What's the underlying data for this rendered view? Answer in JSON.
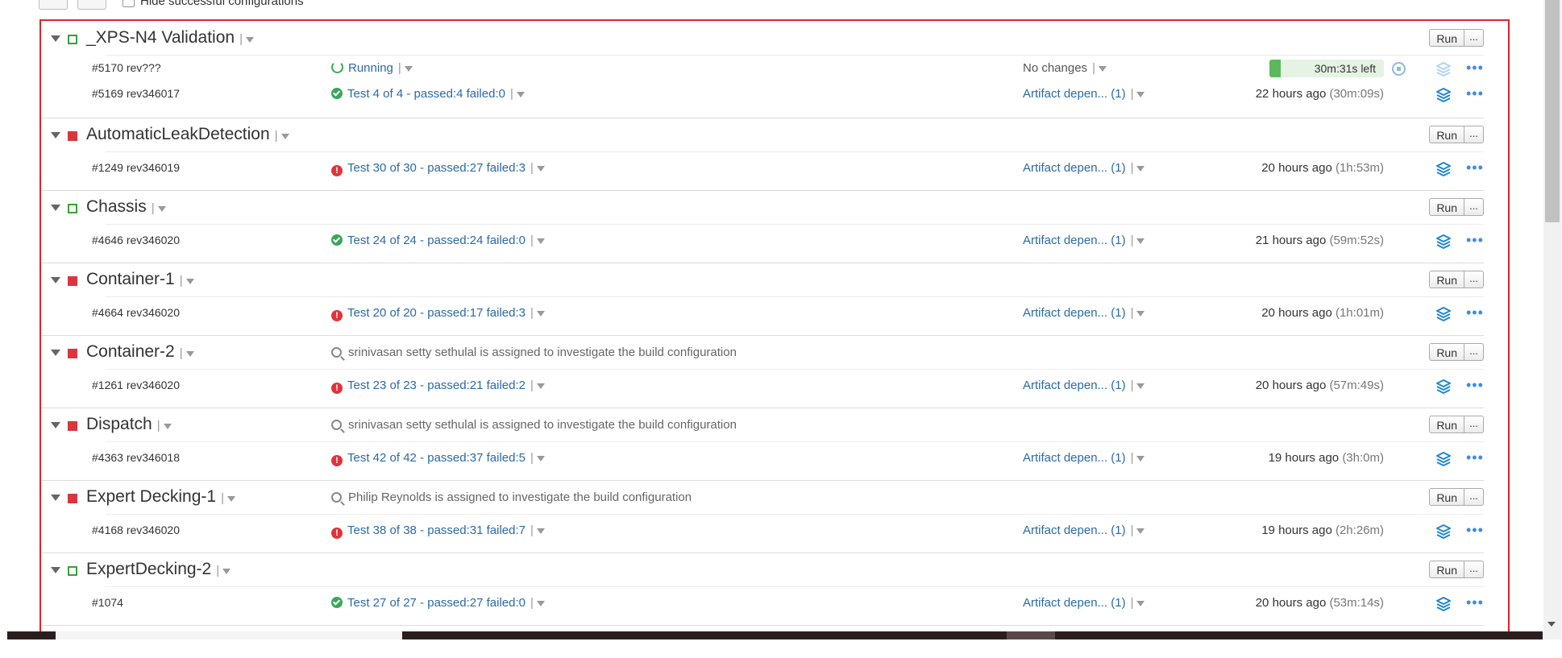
{
  "toolbar": {
    "hide_successful_label": "Hide successful configurations"
  },
  "run_label": "Run",
  "more_label": "...",
  "ellipsis_icon": "•••",
  "colors": {
    "success": "#3aa757",
    "failure": "#d9363e",
    "link": "#2a6aa8",
    "frame_highlight": "#e0242b"
  },
  "groups": [
    {
      "name": "_XPS-N4 Validation",
      "status": "success",
      "investigation": "",
      "builds": [
        {
          "number": "#5170 rev???",
          "status_icon": "running-icon",
          "status_text": "Running",
          "changes": "No changes",
          "time": "",
          "duration": "",
          "progress_text": "30m:31s left",
          "progress_fraction": 0.1
        },
        {
          "number": "#5169 rev346017",
          "status_icon": "success-icon",
          "status_text": "Test 4 of 4 - passed:4 failed:0",
          "changes": "Artifact depen... (1)",
          "time": "22 hours ago",
          "duration": "(30m:09s)"
        }
      ]
    },
    {
      "name": "AutomaticLeakDetection",
      "status": "failure",
      "investigation": "",
      "builds": [
        {
          "number": "#1249 rev346019",
          "status_icon": "error-icon",
          "status_text": "Test 30 of 30 - passed:27 failed:3",
          "changes": "Artifact depen... (1)",
          "time": "20 hours ago",
          "duration": "(1h:53m)"
        }
      ]
    },
    {
      "name": "Chassis",
      "status": "success",
      "investigation": "",
      "builds": [
        {
          "number": "#4646 rev346020",
          "status_icon": "success-icon",
          "status_text": "Test 24 of 24 - passed:24 failed:0",
          "changes": "Artifact depen... (1)",
          "time": "21 hours ago",
          "duration": "(59m:52s)"
        }
      ]
    },
    {
      "name": "Container-1",
      "status": "failure",
      "investigation": "",
      "builds": [
        {
          "number": "#4664 rev346020",
          "status_icon": "error-icon",
          "status_text": "Test 20 of 20 - passed:17 failed:3",
          "changes": "Artifact depen... (1)",
          "time": "20 hours ago",
          "duration": "(1h:01m)"
        }
      ]
    },
    {
      "name": "Container-2",
      "status": "failure",
      "investigation": "srinivasan setty sethulal is assigned to investigate the build configuration",
      "builds": [
        {
          "number": "#1261 rev346020",
          "status_icon": "error-icon",
          "status_text": "Test 23 of 23 - passed:21 failed:2",
          "changes": "Artifact depen... (1)",
          "time": "20 hours ago",
          "duration": "(57m:49s)"
        }
      ]
    },
    {
      "name": "Dispatch",
      "status": "failure",
      "investigation": "srinivasan setty sethulal is assigned to investigate the build configuration",
      "builds": [
        {
          "number": "#4363 rev346018",
          "status_icon": "error-icon",
          "status_text": "Test 42 of 42 - passed:37 failed:5",
          "changes": "Artifact depen... (1)",
          "time": "19 hours ago",
          "duration": "(3h:0m)"
        }
      ]
    },
    {
      "name": "Expert Decking-1",
      "status": "failure",
      "investigation": "Philip Reynolds is assigned to investigate the build configuration",
      "builds": [
        {
          "number": "#4168 rev346020",
          "status_icon": "error-icon",
          "status_text": "Test 38 of 38 - passed:31 failed:7",
          "changes": "Artifact depen... (1)",
          "time": "19 hours ago",
          "duration": "(2h:26m)"
        }
      ]
    },
    {
      "name": "ExpertDecking-2",
      "status": "success",
      "investigation": "",
      "builds": [
        {
          "number": "#1074",
          "status_icon": "success-icon",
          "status_text": "Test 27 of 27 - passed:27 failed:0",
          "changes": "Artifact depen... (1)",
          "time": "20 hours ago",
          "duration": "(53m:14s)"
        }
      ]
    }
  ]
}
